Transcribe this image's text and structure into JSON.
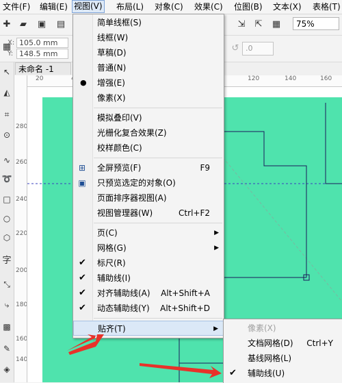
{
  "menubar": {
    "items": [
      "文件(F)",
      "编辑(E)",
      "视图(V)",
      "布局(L)",
      "对象(C)",
      "效果(C)",
      "位图(B)",
      "文本(X)",
      "表格(T)"
    ]
  },
  "toolbar": {
    "zoom": "75%"
  },
  "property_bar": {
    "x_label": "X:",
    "x_value": "105.0 mm",
    "y_label": "Y:",
    "y_value": "148.5 mm",
    "angle_value": ".0"
  },
  "document_tab": {
    "title": "未命名 -1"
  },
  "rulers": {
    "h_ticks": [
      "20",
      "40",
      "60",
      "80",
      "100",
      "120",
      "140",
      "160"
    ],
    "v_ticks": [
      "280",
      "260",
      "240",
      "220",
      "200",
      "180",
      "160",
      "140",
      "120",
      "100"
    ]
  },
  "view_menu": {
    "items": [
      {
        "label": "简单线框(S)"
      },
      {
        "label": "线框(W)"
      },
      {
        "label": "草稿(D)"
      },
      {
        "label": "普通(N)"
      },
      {
        "label": "增强(E)",
        "selected": true
      },
      {
        "label": "像素(X)"
      },
      {
        "label": "模拟叠印(V)"
      },
      {
        "label": "光栅化复合效果(Z)"
      },
      {
        "label": "校样颜色(C)"
      },
      {
        "label": "全屏预览(F)",
        "shortcut": "F9",
        "icon": "fullscreen-preview-icon"
      },
      {
        "label": "只预览选定的对象(O)",
        "icon": "preview-selected-icon"
      },
      {
        "label": "页面排序器视图(A)"
      },
      {
        "label": "视图管理器(W)",
        "shortcut": "Ctrl+F2"
      },
      {
        "label": "页(C)",
        "submenu": true
      },
      {
        "label": "网格(G)",
        "submenu": true
      },
      {
        "label": "标尺(R)",
        "checked": true
      },
      {
        "label": "辅助线(I)",
        "checked": true
      },
      {
        "label": "对齐辅助线(A)",
        "shortcut": "Alt+Shift+A",
        "checked": true
      },
      {
        "label": "动态辅助线(Y)",
        "shortcut": "Alt+Shift+D",
        "checked": true
      },
      {
        "label": "贴齐(T)",
        "submenu": true,
        "highlighted": true
      }
    ]
  },
  "snap_submenu": {
    "items": [
      {
        "label": "像素(X)",
        "disabled": true
      },
      {
        "label": "文档网格(D)",
        "shortcut": "Ctrl+Y"
      },
      {
        "label": "基线网格(L)"
      },
      {
        "label": "辅助线(U)",
        "checked": true
      }
    ]
  },
  "colors": {
    "page_green": "#4fe3ad",
    "arrow_red": "#e8322a",
    "menu_highlight": "#dbe8f7"
  }
}
